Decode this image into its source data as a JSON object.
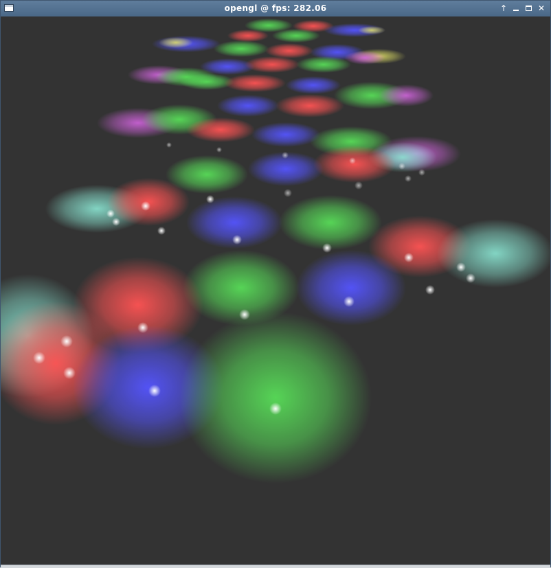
{
  "window": {
    "title": "opengl @ fps: 282.06",
    "controls": {
      "up_glyph": "↑",
      "close_glyph": "✕"
    },
    "icons": [
      "app-window-icon",
      "arrow-up-icon",
      "minimize-icon",
      "maximize-icon",
      "close-icon"
    ]
  },
  "scene": {
    "description_colors": {
      "background": "#333333",
      "red": "#ff2020",
      "green": "#20d020",
      "blue": "#2020ff"
    }
  }
}
